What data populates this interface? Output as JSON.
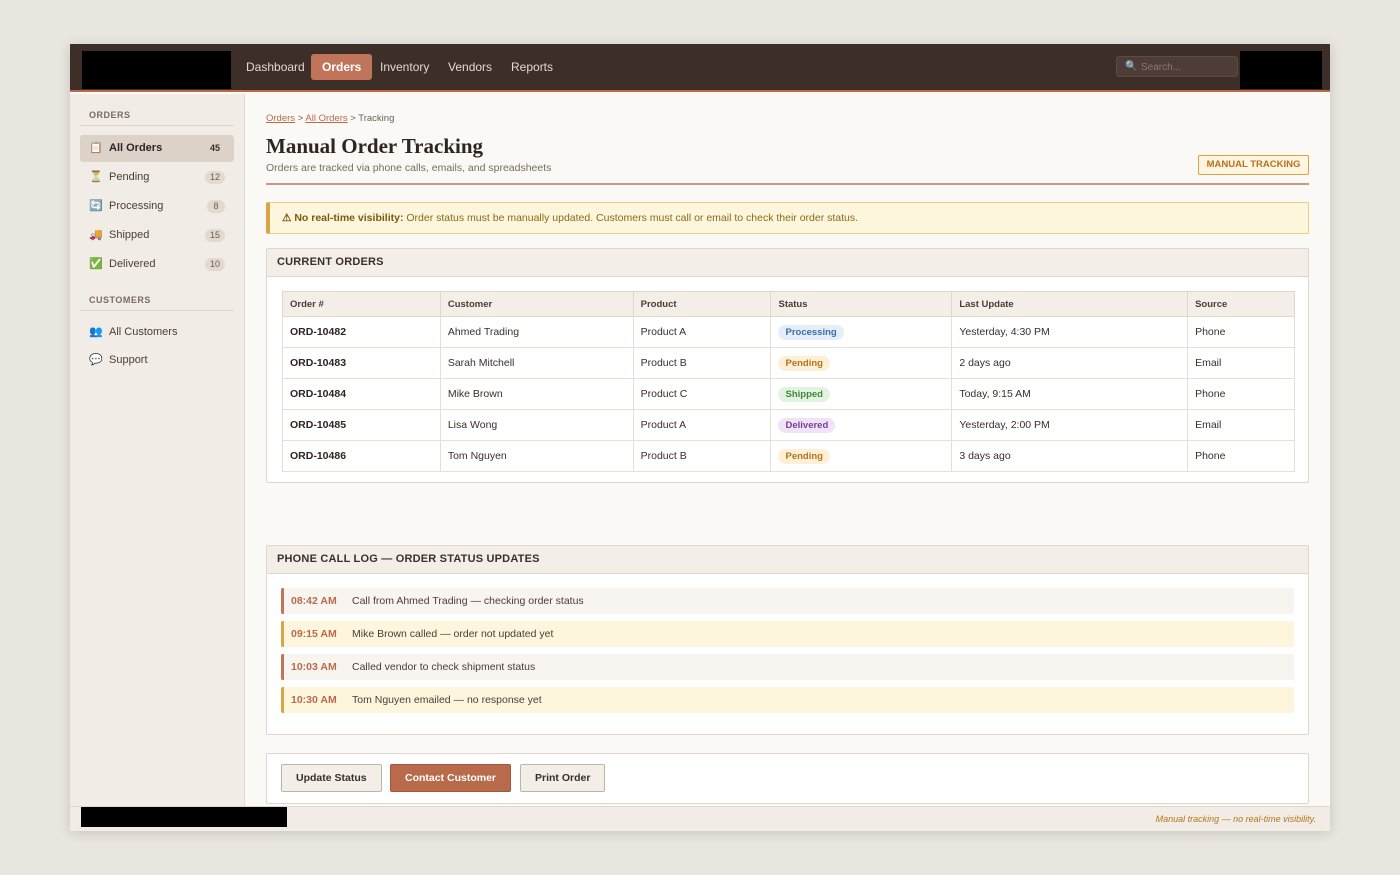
{
  "nav": {
    "items": [
      {
        "label": "Dashboard",
        "active": false
      },
      {
        "label": "Orders",
        "active": true
      },
      {
        "label": "Inventory",
        "active": false
      },
      {
        "label": "Vendors",
        "active": false
      },
      {
        "label": "Reports",
        "active": false
      }
    ],
    "search_placeholder": "Search..."
  },
  "sidebar": {
    "orders_heading": "ORDERS",
    "order_items": [
      {
        "icon": "clipboard-icon",
        "label": "All Orders",
        "count": "45",
        "active": true
      },
      {
        "icon": "hourglass-icon",
        "label": "Pending",
        "count": "12",
        "active": false
      },
      {
        "icon": "refresh-icon",
        "label": "Processing",
        "count": "8",
        "active": false
      },
      {
        "icon": "truck-icon",
        "label": "Shipped",
        "count": "15",
        "active": false
      },
      {
        "icon": "check-box-icon",
        "label": "Delivered",
        "count": "10",
        "active": false
      }
    ],
    "customers_heading": "CUSTOMERS",
    "customer_items": [
      {
        "icon": "users-icon",
        "label": "All Customers"
      },
      {
        "icon": "chat-bubble-icon",
        "label": "Support"
      }
    ]
  },
  "breadcrumb": {
    "crumb1": "Orders",
    "sep1": ">",
    "crumb2": "All Orders",
    "sep2": ">",
    "current": "Tracking"
  },
  "page": {
    "title": "Manual Order Tracking",
    "subtitle": "Orders are tracked via phone calls, emails, and spreadsheets",
    "badge": "MANUAL TRACKING"
  },
  "warning": {
    "icon": "warning-icon",
    "bold": "⚠ No real-time visibility:",
    "text": " Order status must be manually updated. Customers must call or email to check their order status."
  },
  "orders_panel": {
    "title": "CURRENT ORDERS",
    "columns": [
      "Order #",
      "Customer",
      "Product",
      "Status",
      "Last Update",
      "Source"
    ],
    "rows": [
      {
        "order": "ORD-10482",
        "customer": "Ahmed Trading",
        "product": "Product A",
        "status": "Processing",
        "last_update": "Yesterday, 4:30 PM",
        "source": "Phone"
      },
      {
        "order": "ORD-10483",
        "customer": "Sarah Mitchell",
        "product": "Product B",
        "status": "Pending",
        "last_update": "2 days ago",
        "source": "Email"
      },
      {
        "order": "ORD-10484",
        "customer": "Mike Brown",
        "product": "Product C",
        "status": "Shipped",
        "last_update": "Today, 9:15 AM",
        "source": "Phone"
      },
      {
        "order": "ORD-10485",
        "customer": "Lisa Wong",
        "product": "Product A",
        "status": "Delivered",
        "last_update": "Yesterday, 2:00 PM",
        "source": "Email"
      },
      {
        "order": "ORD-10486",
        "customer": "Tom Nguyen",
        "product": "Product B",
        "status": "Pending",
        "last_update": "3 days ago",
        "source": "Phone"
      }
    ],
    "status_colors": {
      "Processing": {
        "bg": "#e3eefa",
        "fg": "#3a6ea8"
      },
      "Pending": {
        "bg": "#fdf0d6",
        "fg": "#b3741d"
      },
      "Shipped": {
        "bg": "#e2f3e1",
        "fg": "#3d8a3c"
      },
      "Delivered": {
        "bg": "#efe3f5",
        "fg": "#7a3e96"
      }
    }
  },
  "log_panel": {
    "title": "PHONE CALL LOG — ORDER STATUS UPDATES",
    "entries": [
      {
        "time": "08:42 AM",
        "message": "Call from Ahmed Trading — checking order status",
        "kind": "call"
      },
      {
        "time": "09:15 AM",
        "message": "Mike Brown called — order not updated yet",
        "kind": "warn"
      },
      {
        "time": "10:03 AM",
        "message": "Called vendor to check shipment status",
        "kind": "call"
      },
      {
        "time": "10:30 AM",
        "message": "Tom Nguyen emailed — no response yet",
        "kind": "warn"
      }
    ]
  },
  "actions": {
    "update_label": "Update Status",
    "contact_label": "Contact Customer",
    "print_label": "Print Order"
  },
  "footer": {
    "note": "Manual tracking — no real-time visibility."
  },
  "colors": {
    "accent": "#b86a4b",
    "nav_bg": "#3d2e28",
    "warning": "#d9a441"
  }
}
